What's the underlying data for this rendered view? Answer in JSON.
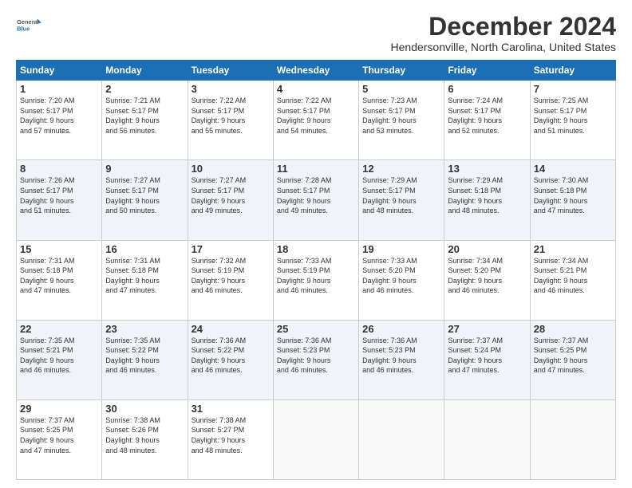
{
  "logo": {
    "line1": "General",
    "line2": "Blue"
  },
  "title": "December 2024",
  "location": "Hendersonville, North Carolina, United States",
  "weekdays": [
    "Sunday",
    "Monday",
    "Tuesday",
    "Wednesday",
    "Thursday",
    "Friday",
    "Saturday"
  ],
  "weeks": [
    [
      {
        "day": "1",
        "info": "Sunrise: 7:20 AM\nSunset: 5:17 PM\nDaylight: 9 hours\nand 57 minutes."
      },
      {
        "day": "2",
        "info": "Sunrise: 7:21 AM\nSunset: 5:17 PM\nDaylight: 9 hours\nand 56 minutes."
      },
      {
        "day": "3",
        "info": "Sunrise: 7:22 AM\nSunset: 5:17 PM\nDaylight: 9 hours\nand 55 minutes."
      },
      {
        "day": "4",
        "info": "Sunrise: 7:22 AM\nSunset: 5:17 PM\nDaylight: 9 hours\nand 54 minutes."
      },
      {
        "day": "5",
        "info": "Sunrise: 7:23 AM\nSunset: 5:17 PM\nDaylight: 9 hours\nand 53 minutes."
      },
      {
        "day": "6",
        "info": "Sunrise: 7:24 AM\nSunset: 5:17 PM\nDaylight: 9 hours\nand 52 minutes."
      },
      {
        "day": "7",
        "info": "Sunrise: 7:25 AM\nSunset: 5:17 PM\nDaylight: 9 hours\nand 51 minutes."
      }
    ],
    [
      {
        "day": "8",
        "info": "Sunrise: 7:26 AM\nSunset: 5:17 PM\nDaylight: 9 hours\nand 51 minutes."
      },
      {
        "day": "9",
        "info": "Sunrise: 7:27 AM\nSunset: 5:17 PM\nDaylight: 9 hours\nand 50 minutes."
      },
      {
        "day": "10",
        "info": "Sunrise: 7:27 AM\nSunset: 5:17 PM\nDaylight: 9 hours\nand 49 minutes."
      },
      {
        "day": "11",
        "info": "Sunrise: 7:28 AM\nSunset: 5:17 PM\nDaylight: 9 hours\nand 49 minutes."
      },
      {
        "day": "12",
        "info": "Sunrise: 7:29 AM\nSunset: 5:17 PM\nDaylight: 9 hours\nand 48 minutes."
      },
      {
        "day": "13",
        "info": "Sunrise: 7:29 AM\nSunset: 5:18 PM\nDaylight: 9 hours\nand 48 minutes."
      },
      {
        "day": "14",
        "info": "Sunrise: 7:30 AM\nSunset: 5:18 PM\nDaylight: 9 hours\nand 47 minutes."
      }
    ],
    [
      {
        "day": "15",
        "info": "Sunrise: 7:31 AM\nSunset: 5:18 PM\nDaylight: 9 hours\nand 47 minutes."
      },
      {
        "day": "16",
        "info": "Sunrise: 7:31 AM\nSunset: 5:18 PM\nDaylight: 9 hours\nand 47 minutes."
      },
      {
        "day": "17",
        "info": "Sunrise: 7:32 AM\nSunset: 5:19 PM\nDaylight: 9 hours\nand 46 minutes."
      },
      {
        "day": "18",
        "info": "Sunrise: 7:33 AM\nSunset: 5:19 PM\nDaylight: 9 hours\nand 46 minutes."
      },
      {
        "day": "19",
        "info": "Sunrise: 7:33 AM\nSunset: 5:20 PM\nDaylight: 9 hours\nand 46 minutes."
      },
      {
        "day": "20",
        "info": "Sunrise: 7:34 AM\nSunset: 5:20 PM\nDaylight: 9 hours\nand 46 minutes."
      },
      {
        "day": "21",
        "info": "Sunrise: 7:34 AM\nSunset: 5:21 PM\nDaylight: 9 hours\nand 46 minutes."
      }
    ],
    [
      {
        "day": "22",
        "info": "Sunrise: 7:35 AM\nSunset: 5:21 PM\nDaylight: 9 hours\nand 46 minutes."
      },
      {
        "day": "23",
        "info": "Sunrise: 7:35 AM\nSunset: 5:22 PM\nDaylight: 9 hours\nand 46 minutes."
      },
      {
        "day": "24",
        "info": "Sunrise: 7:36 AM\nSunset: 5:22 PM\nDaylight: 9 hours\nand 46 minutes."
      },
      {
        "day": "25",
        "info": "Sunrise: 7:36 AM\nSunset: 5:23 PM\nDaylight: 9 hours\nand 46 minutes."
      },
      {
        "day": "26",
        "info": "Sunrise: 7:36 AM\nSunset: 5:23 PM\nDaylight: 9 hours\nand 46 minutes."
      },
      {
        "day": "27",
        "info": "Sunrise: 7:37 AM\nSunset: 5:24 PM\nDaylight: 9 hours\nand 47 minutes."
      },
      {
        "day": "28",
        "info": "Sunrise: 7:37 AM\nSunset: 5:25 PM\nDaylight: 9 hours\nand 47 minutes."
      }
    ],
    [
      {
        "day": "29",
        "info": "Sunrise: 7:37 AM\nSunset: 5:25 PM\nDaylight: 9 hours\nand 47 minutes."
      },
      {
        "day": "30",
        "info": "Sunrise: 7:38 AM\nSunset: 5:26 PM\nDaylight: 9 hours\nand 48 minutes."
      },
      {
        "day": "31",
        "info": "Sunrise: 7:38 AM\nSunset: 5:27 PM\nDaylight: 9 hours\nand 48 minutes."
      },
      {
        "day": "",
        "info": ""
      },
      {
        "day": "",
        "info": ""
      },
      {
        "day": "",
        "info": ""
      },
      {
        "day": "",
        "info": ""
      }
    ]
  ]
}
